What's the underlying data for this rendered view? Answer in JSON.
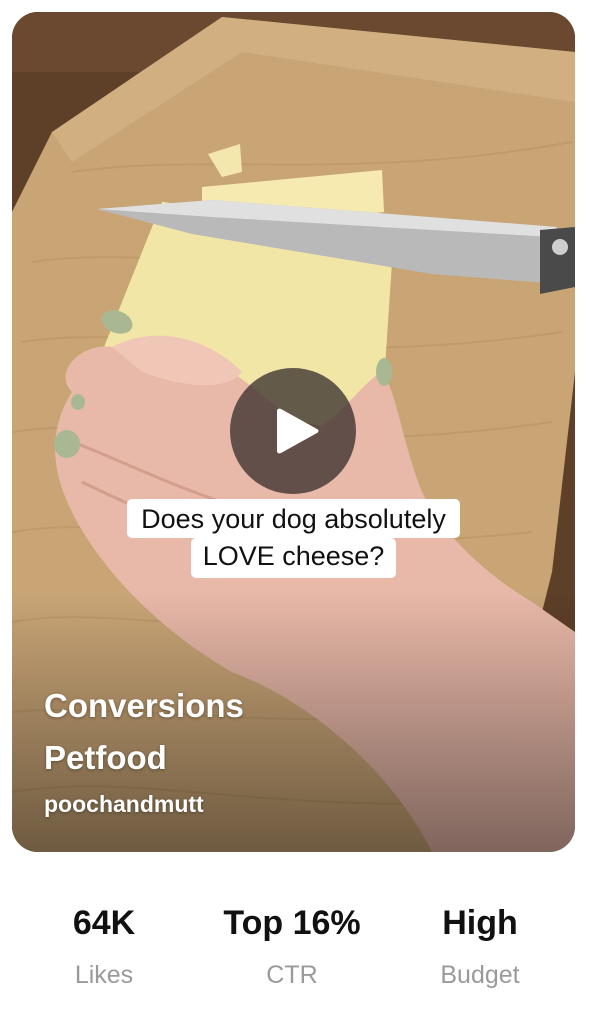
{
  "video": {
    "caption_line1": "Does your dog absolutely",
    "caption_line2": "LOVE cheese?",
    "title_line1": "Conversions",
    "title_line2": "Petfood",
    "handle": "poochandmutt",
    "play_icon": "play-icon"
  },
  "stats": [
    {
      "value": "64K",
      "label": "Likes"
    },
    {
      "value": "Top 16%",
      "label": "CTR"
    },
    {
      "value": "High",
      "label": "Budget"
    }
  ],
  "colors": {
    "card_background": "#6b4a30",
    "board": "#c9a576",
    "cheese": "#f2e6a6",
    "skin": "#e8b8a8",
    "nail_polish": "#a9b892",
    "label_gray": "#9a9a9a"
  }
}
